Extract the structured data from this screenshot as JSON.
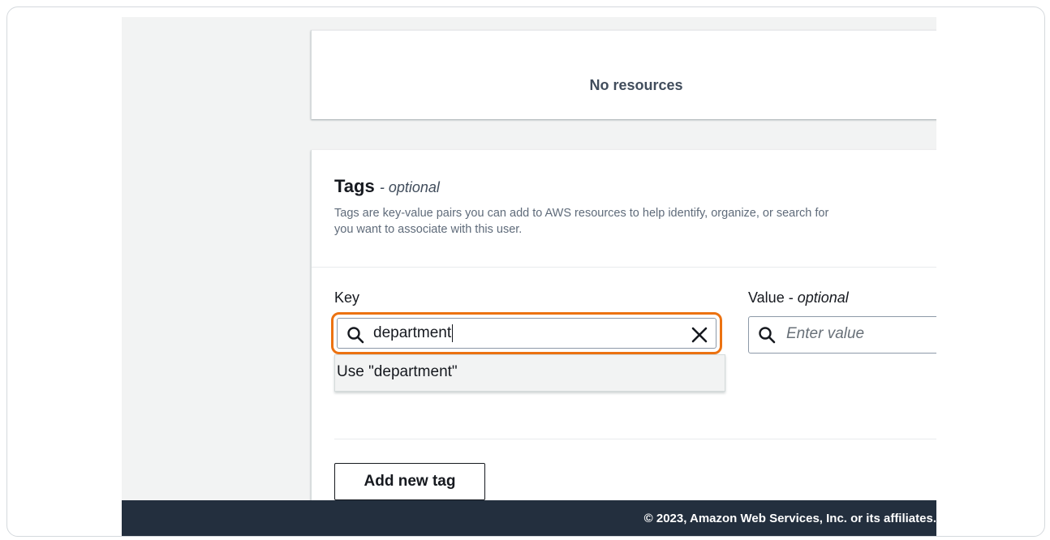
{
  "resources_panel": {
    "empty_text": "No resources"
  },
  "tags": {
    "title": "Tags",
    "title_suffix": "- optional",
    "description_line1": "Tags are key-value pairs you can add to AWS resources to help identify, organize, or search for",
    "description_line2": "you want to associate with this user.",
    "key_label": "Key",
    "value_label": "Value -",
    "value_label_suffix": "optional",
    "key_input_value": "department",
    "value_placeholder": "Enter value",
    "suggestion": "Use \"department\"",
    "add_button_label": "Add new tag"
  },
  "footer": {
    "copyright": "© 2023, Amazon Web Services, Inc. or its affiliates."
  },
  "colors": {
    "highlight": "#ec7211",
    "footer_bg": "#232f3e",
    "page_bg": "#f2f3f3"
  },
  "icons": {
    "key_search": "search-icon",
    "value_search": "search-icon",
    "clear": "close-icon"
  }
}
